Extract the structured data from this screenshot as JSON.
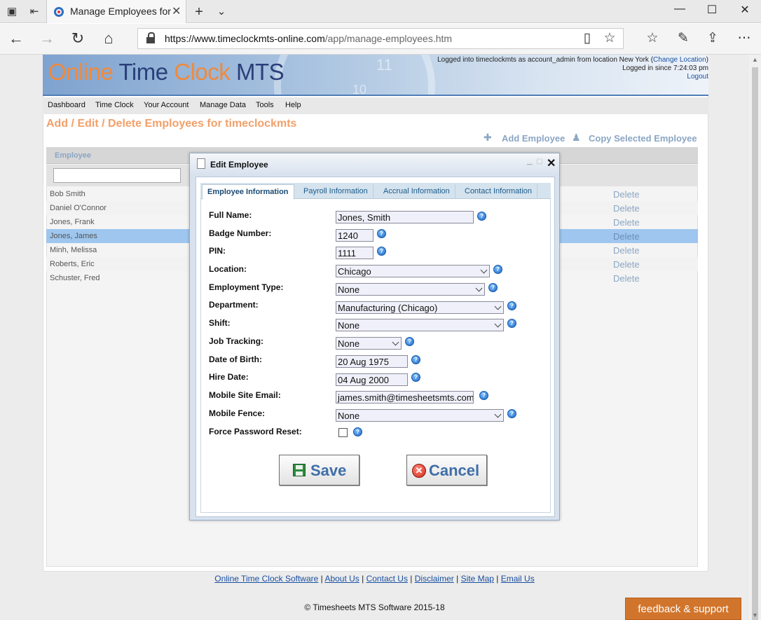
{
  "browser": {
    "tab_title": "Manage Employees for",
    "url_host": "https://www.timeclockmts-online.com",
    "url_path": "/app/manage-employees.htm"
  },
  "header": {
    "logo_online": "Online",
    "logo_time": "Time",
    "logo_clock": "Clock",
    "logo_mts": "MTS",
    "clock_num_1": "11",
    "clock_num_2": "10",
    "login_line1_prefix": "Logged into timeclockmts as account_admin from location New York (",
    "change_location": "Change Location",
    "login_line1_suffix": ")",
    "login_line2": "Logged in since 7:24:03 pm",
    "logout": "Logout"
  },
  "menu": [
    "Dashboard",
    "Time Clock",
    "Your Account",
    "Manage Data",
    "Tools",
    "Help"
  ],
  "page": {
    "title": "Add / Edit / Delete Employees for timeclockmts",
    "add_employee": "Add Employee",
    "copy_employee": "Copy Selected Employee",
    "grid_col_employee": "Employee"
  },
  "employees": [
    {
      "name": "Bob Smith",
      "action": "Delete"
    },
    {
      "name": "Daniel O'Connor",
      "action": "Delete"
    },
    {
      "name": "Jones, Frank",
      "action": "Delete"
    },
    {
      "name": "Jones, James",
      "action": "Delete"
    },
    {
      "name": "Minh, Melissa",
      "action": "Delete"
    },
    {
      "name": "Roberts, Eric",
      "action": "Delete"
    },
    {
      "name": "Schuster, Fred",
      "action": "Delete"
    }
  ],
  "modal": {
    "title": "Edit Employee",
    "tabs": [
      "Employee Information",
      "Payroll Information",
      "Accrual Information",
      "Contact Information"
    ],
    "fields": {
      "full_name": {
        "label": "Full Name:",
        "value": "Jones, Smith"
      },
      "badge": {
        "label": "Badge Number:",
        "value": "1240"
      },
      "pin": {
        "label": "PIN:",
        "value": "1111"
      },
      "location": {
        "label": "Location:",
        "value": "Chicago"
      },
      "emp_type": {
        "label": "Employment Type:",
        "value": "None"
      },
      "department": {
        "label": "Department:",
        "value": "Manufacturing (Chicago)"
      },
      "shift": {
        "label": "Shift:",
        "value": "None"
      },
      "job_tracking": {
        "label": "Job Tracking:",
        "value": "None"
      },
      "dob": {
        "label": "Date of Birth:",
        "value": "20 Aug 1975"
      },
      "hire_date": {
        "label": "Hire Date:",
        "value": "04 Aug 2000"
      },
      "mobile_email": {
        "label": "Mobile Site Email:",
        "value": "james.smith@timesheetsmts.com"
      },
      "mobile_fence": {
        "label": "Mobile Fence:",
        "value": "None"
      },
      "force_reset": {
        "label": "Force Password Reset:"
      }
    },
    "save_label": "Save",
    "cancel_label": "Cancel"
  },
  "footer": {
    "links": [
      "Online Time Clock Software",
      "About Us",
      "Contact Us",
      "Disclaimer",
      "Site Map",
      "Email Us"
    ],
    "copyright": "© Timesheets MTS Software 2015-18",
    "feedback": "feedback & support"
  }
}
